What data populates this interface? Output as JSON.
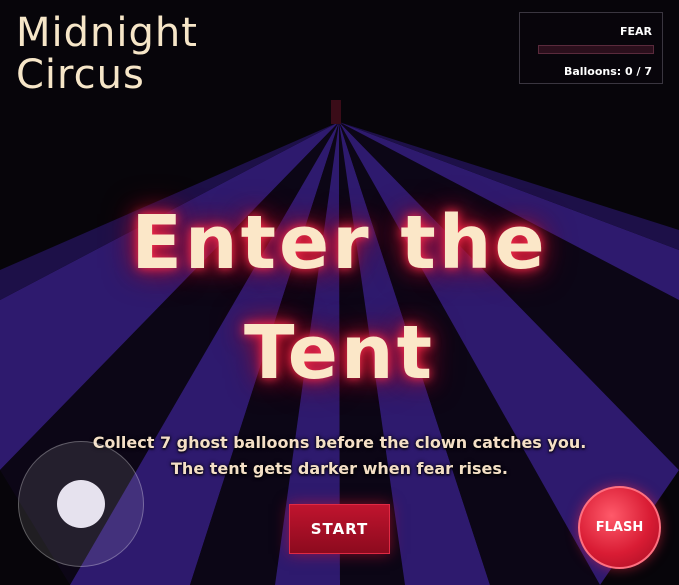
{
  "game": {
    "title_line1": "Midnight",
    "title_line2": "Circus"
  },
  "hud": {
    "fear_label": "FEAR",
    "fear_level": 0,
    "balloons_text": "Balloons: 0 / 7"
  },
  "overlay": {
    "headline_line1": "Enter the",
    "headline_line2": "Tent",
    "instruction_line1": "Collect 7 ghost balloons before the clown catches you.",
    "instruction_line2": "The tent gets darker when fear rises.",
    "start_label": "START"
  },
  "controls": {
    "joystick": "virtual-joystick",
    "flash_label": "FLASH"
  },
  "colors": {
    "background": "#07050a",
    "stripe_purple": "#2e1a6e",
    "stripe_dark": "#0c0616",
    "accent_red": "#c0142e",
    "text_cream": "#fbe7c8"
  }
}
